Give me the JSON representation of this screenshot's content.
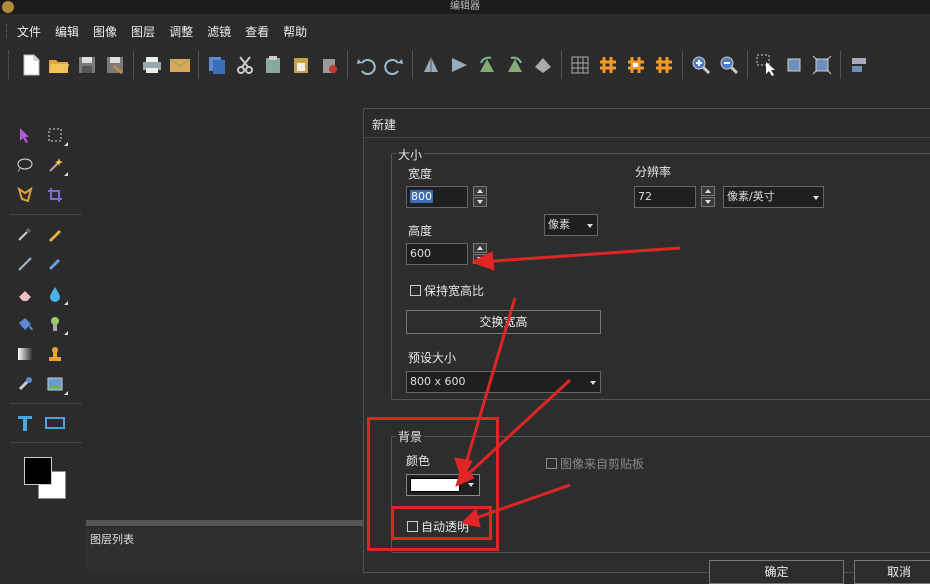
{
  "window": {
    "title": "编辑器"
  },
  "menu": [
    "文件",
    "编辑",
    "图像",
    "图层",
    "调整",
    "滤镜",
    "查看",
    "帮助"
  ],
  "toolbar": [
    "new-file-icon",
    "open-folder-icon",
    "save-icon",
    "save-as-icon",
    "print-icon",
    "email-icon",
    "copy-icon",
    "cut-icon",
    "paste-icon",
    "paste-into-icon",
    "clear-icon",
    "undo-icon",
    "redo-icon",
    "flip-vertical-icon",
    "flip-horizontal-icon",
    "rotate-left-icon",
    "rotate-right-icon",
    "rotate-free-icon",
    "grid-icon",
    "hash-icon",
    "hash-snap-icon",
    "hash-alt-icon",
    "zoom-in-icon",
    "zoom-out-icon",
    "select-pointer-icon",
    "crop-canvas-icon",
    "resize-canvas-icon",
    "align-icon"
  ],
  "layers_panel": {
    "title": "图层列表"
  },
  "dialog": {
    "title": "新建",
    "size_group": "大小",
    "width_label": "宽度",
    "width_value": "800",
    "height_label": "高度",
    "height_value": "600",
    "unit_select": "像素",
    "resolution_label": "分辨率",
    "resolution_value": "72",
    "resolution_unit": "像素/英寸",
    "keep_ratio": "保持宽高比",
    "swap_button": "交换宽高",
    "preset_label": "预设大小",
    "preset_value": "800 x 600",
    "background_group": "背景",
    "color_label": "颜色",
    "color_value": "#ffffff",
    "from_clipboard": "图像来自剪贴板",
    "auto_transparent": "自动透明",
    "ok_button": "确定",
    "cancel_button": "取消"
  },
  "colors": {
    "annotation": "#e02525",
    "foreground": "#000000",
    "background": "#ffffff",
    "selection": "#3b6db3"
  }
}
